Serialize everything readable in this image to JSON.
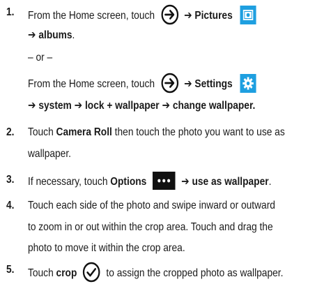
{
  "step1": {
    "num": "1.",
    "line1_pre": "From the Home screen, touch",
    "arrow": "➔",
    "pictures": "Pictures",
    "line2_albums": "albums",
    "line2_period": ".",
    "or": "– or –",
    "line4_pre": "From the Home screen, touch",
    "settings": "Settings",
    "line5": "system ➔ lock + wallpaper ➔ change wallpaper."
  },
  "step2": {
    "num": "2.",
    "pre": "Touch",
    "camera_roll": "Camera Roll",
    "post": "then touch the photo you want to use as",
    "line2": "wallpaper."
  },
  "step3": {
    "num": "3.",
    "pre": "If necessary, touch",
    "options": "Options",
    "post": "use as wallpaper",
    "period": "."
  },
  "step4": {
    "num": "4.",
    "line1": "Touch each side of the photo and swipe inward or outward",
    "line2": "to zoom in or out within the crop area. Touch and drag the",
    "line3": "photo to move it within the crop area."
  },
  "step5": {
    "num": "5.",
    "pre": "Touch",
    "crop": "crop",
    "post": "to assign the cropped photo as wallpaper."
  },
  "icons": {
    "apps_arrow": "right-arrow-circle-icon",
    "pictures": "pictures-camera-icon",
    "settings": "settings-gear-icon",
    "options": "options-ellipsis-icon",
    "crop": "crop-checkmark-icon"
  },
  "colors": {
    "accent_blue": "#1e9fe0",
    "text": "#1a1a1a",
    "black_tile": "#111111"
  }
}
